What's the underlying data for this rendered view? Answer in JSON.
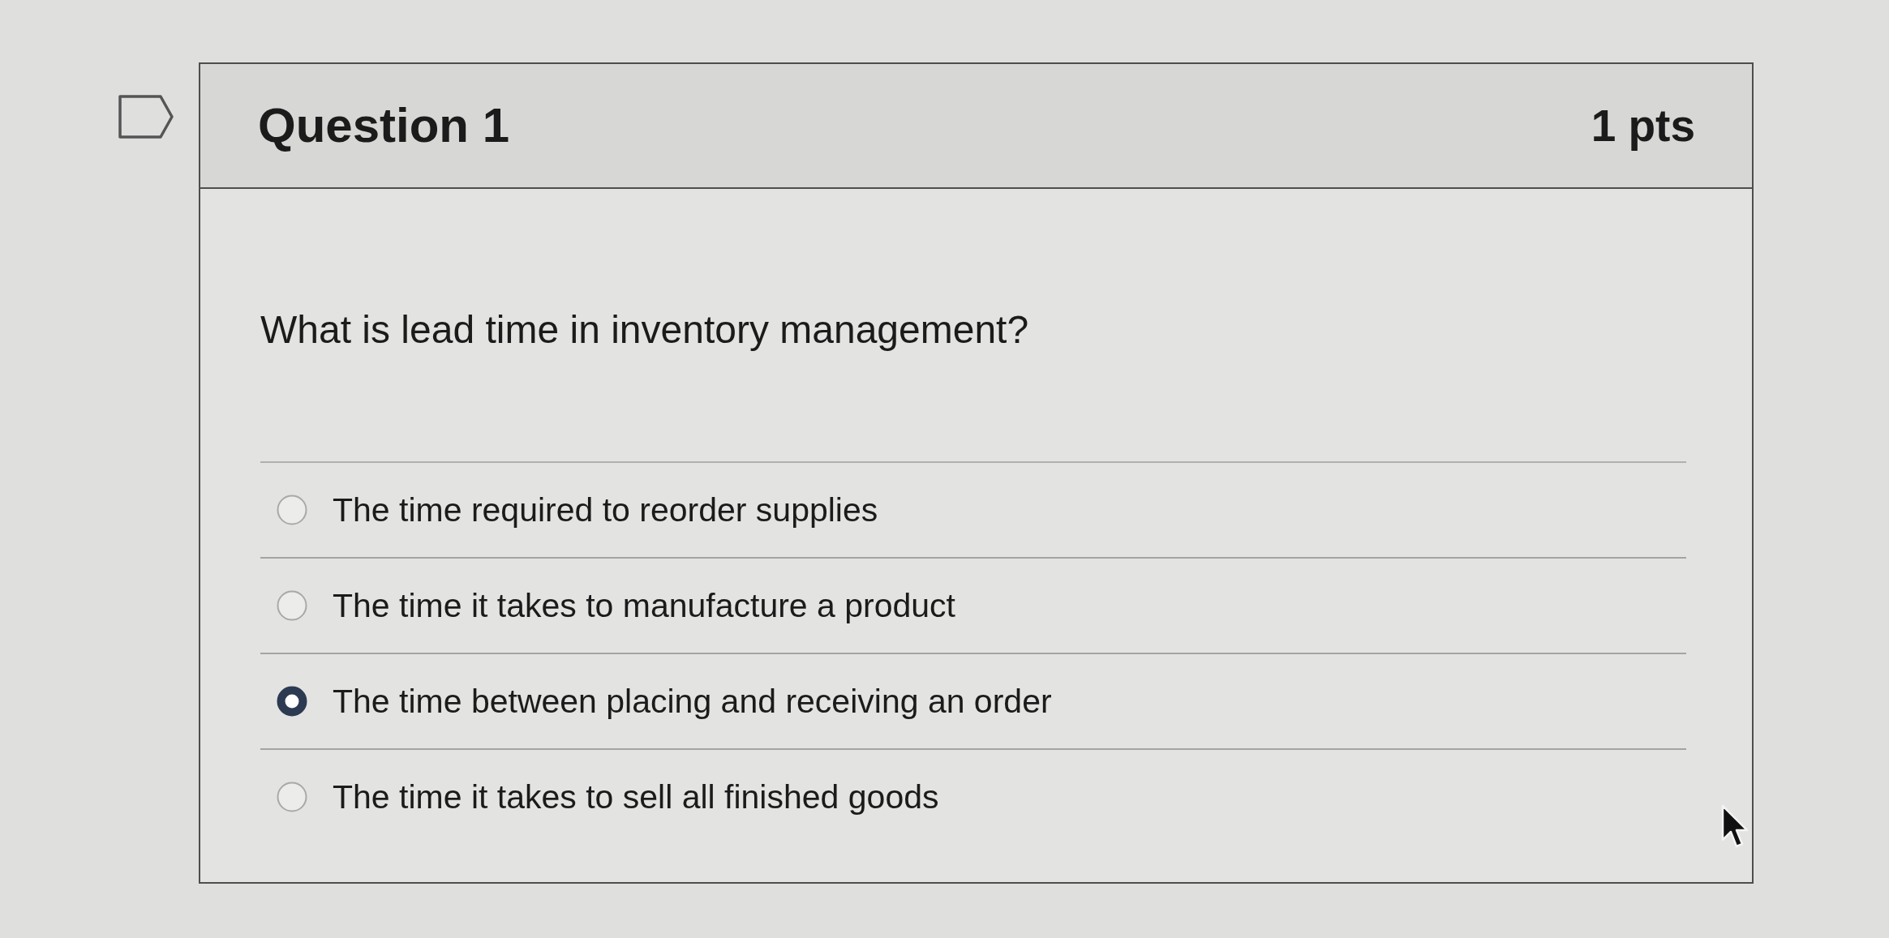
{
  "question": {
    "flagged": false,
    "title": "Question 1",
    "points": "1 pts",
    "prompt": "What is lead time in inventory management?",
    "answers": [
      {
        "label": "The time required to reorder supplies",
        "selected": false
      },
      {
        "label": "The time it takes to manufacture a product",
        "selected": false
      },
      {
        "label": "The time between placing and receiving an order",
        "selected": true
      },
      {
        "label": "The time it takes to sell all finished goods",
        "selected": false
      }
    ]
  }
}
